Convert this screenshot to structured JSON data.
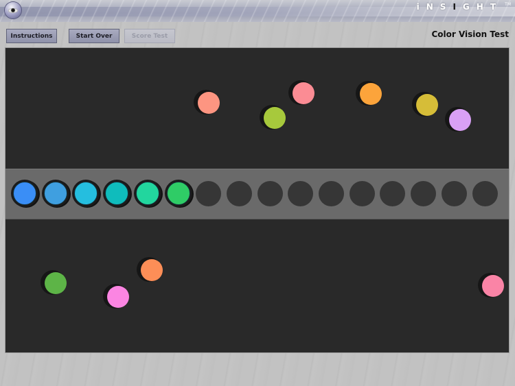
{
  "header": {
    "logo_icon": "eye-icon",
    "brand_prefix": "iNS",
    "brand_highlight": "I",
    "brand_suffix": "GHT",
    "trademark": "TM"
  },
  "toolbar": {
    "instructions_label": "Instructions",
    "start_over_label": "Start Over",
    "score_test_label": "Score Test",
    "score_test_enabled": false
  },
  "page_title": "Color Vision Test",
  "tray": {
    "total_slots": 16,
    "placed_caps": [
      {
        "color": "#3a8ef6"
      },
      {
        "color": "#3f9fe0"
      },
      {
        "color": "#25bedf"
      },
      {
        "color": "#0fbcbc"
      },
      {
        "color": "#22d69e"
      },
      {
        "color": "#2fcc66"
      }
    ]
  },
  "loose_caps": [
    {
      "color": "#fd9581"
    },
    {
      "color": "#a7c93c"
    },
    {
      "color": "#fb8c94"
    },
    {
      "color": "#fca43b"
    },
    {
      "color": "#d6bd38"
    },
    {
      "color": "#d9a0f5"
    },
    {
      "color": "#5db447"
    },
    {
      "color": "#fd8e57"
    },
    {
      "color": "#fb85e2"
    },
    {
      "color": "#fa84a6"
    }
  ]
}
